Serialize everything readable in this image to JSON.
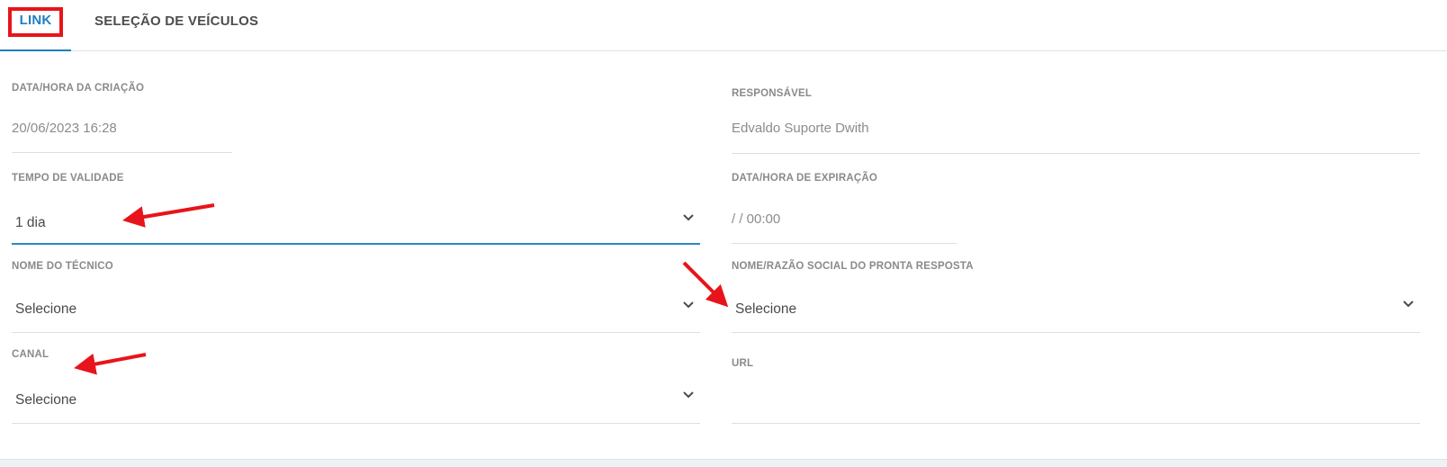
{
  "tabs": [
    {
      "label": "LINK",
      "active": true
    },
    {
      "label": "SELEÇÃO DE VEÍCULOS",
      "active": false
    }
  ],
  "form": {
    "created_at": {
      "label": "DATA/HORA DA CRIAÇÃO",
      "value": "20/06/2023 16:28"
    },
    "responsible": {
      "label": "RESPONSÁVEL",
      "value": "Edvaldo Suporte Dwith"
    },
    "validity": {
      "label": "TEMPO DE VALIDADE",
      "value": "1 dia"
    },
    "expiration": {
      "label": "DATA/HORA DE EXPIRAÇÃO",
      "value": "/ / 00:00"
    },
    "technician": {
      "label": "NOME DO TÉCNICO",
      "value": "Selecione"
    },
    "responder": {
      "label": "NOME/RAZÃO SOCIAL DO PRONTA RESPOSTA",
      "value": "Selecione"
    },
    "channel": {
      "label": "CANAL",
      "value": "Selecione"
    },
    "url": {
      "label": "URL",
      "value": ""
    }
  },
  "colors": {
    "accent": "#1f7fc1",
    "annotation": "#e8141b"
  }
}
